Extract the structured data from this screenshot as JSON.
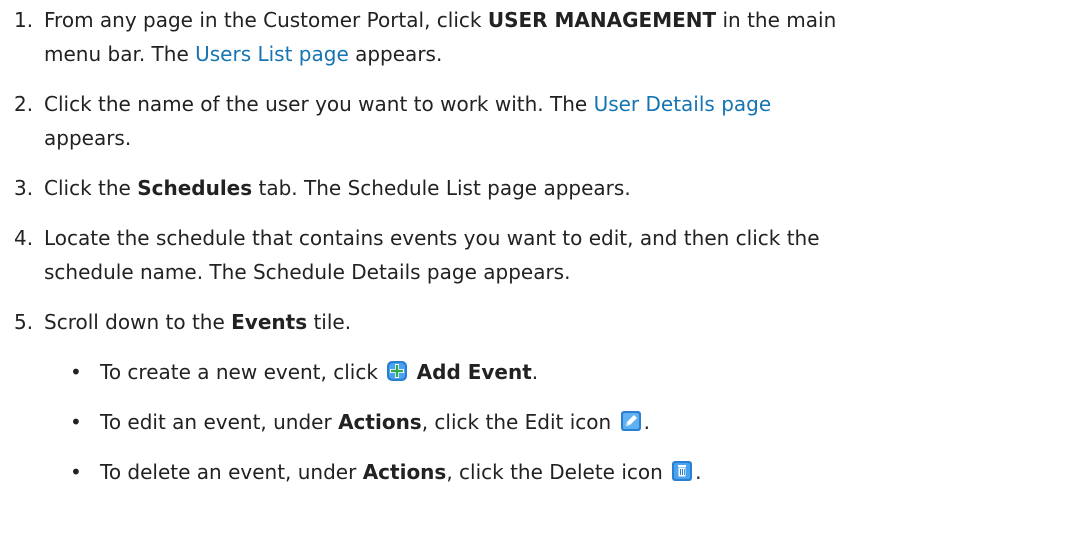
{
  "steps": [
    {
      "number": "1.",
      "lines": [
        {
          "a": "From any page in the Customer Portal, click ",
          "b": "USER MANAGEMENT",
          "c": " in the main"
        },
        {
          "a": "menu bar. The ",
          "link": "Users List page",
          "c": " appears."
        }
      ]
    },
    {
      "number": "2.",
      "lines": [
        {
          "a": "Click the name of the user you want to work with. The ",
          "link": "User Details page"
        },
        {
          "a": "appears."
        }
      ]
    },
    {
      "number": "3.",
      "lines": [
        {
          "a": "Click the ",
          "b": "Schedules",
          "c": " tab. The Schedule List page appears."
        }
      ]
    },
    {
      "number": "4.",
      "lines": [
        {
          "a": "Locate the schedule that contains events you want to edit, and then click the"
        },
        {
          "a": "schedule name. The Schedule Details page appears."
        }
      ]
    },
    {
      "number": "5.",
      "lines": [
        {
          "a": "Scroll down to the ",
          "b": "Events",
          "c": " tile."
        }
      ]
    }
  ],
  "bullets": [
    {
      "a": "To create a new event, click ",
      "icon": "add-icon",
      "b": "Add Event",
      "c": "."
    },
    {
      "a": "To edit an event, under ",
      "b": "Actions",
      "c": ", click the Edit icon ",
      "icon": "edit-icon",
      "d": "."
    },
    {
      "a": "To delete an event, under ",
      "b": "Actions",
      "c": ", click the Delete icon ",
      "icon": "delete-icon",
      "d": "."
    }
  ],
  "colors": {
    "link": "#1574b3",
    "icon_blue": "#2a7fd0",
    "add_icon_green": "#2fa84f"
  }
}
